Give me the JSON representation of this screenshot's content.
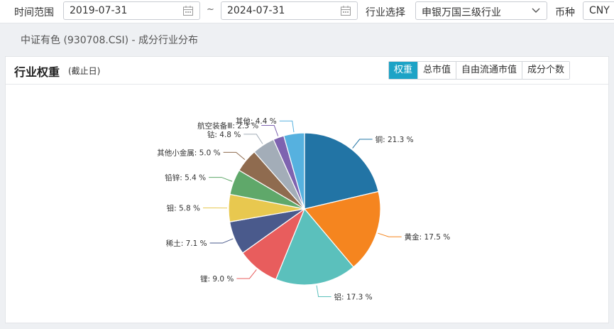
{
  "filters": {
    "time_range_label": "时间范围",
    "start_date": "2019-07-31",
    "separator": "~",
    "end_date": "2024-07-31",
    "industry_label": "行业选择",
    "industry_value": "申银万国三级行业",
    "currency_label": "币种",
    "currency_value": "CNY"
  },
  "page": {
    "subtitle": "中证有色 (930708.CSI) - 成分行业分布"
  },
  "panel": {
    "title": "行业权重",
    "subtitle": "(截止日)",
    "tabs": [
      "权重",
      "总市值",
      "自由流通市值",
      "成分个数"
    ],
    "active_tab": 0
  },
  "chart_data": {
    "type": "pie",
    "title": "",
    "slices": [
      {
        "name": "铜",
        "value": 21.3,
        "label": "铜: 21.3 %",
        "color": "#2274a5"
      },
      {
        "name": "黄金",
        "value": 17.5,
        "label": "黄金: 17.5 %",
        "color": "#f5851f"
      },
      {
        "name": "铝",
        "value": 17.3,
        "label": "铝: 17.3 %",
        "color": "#5bc0bc"
      },
      {
        "name": "锂",
        "value": 9.0,
        "label": "锂: 9.0 %",
        "color": "#e85d5d"
      },
      {
        "name": "稀土",
        "value": 7.1,
        "label": "稀土: 7.1 %",
        "color": "#4a5a8c"
      },
      {
        "name": "钼",
        "value": 5.8,
        "label": "钼: 5.8 %",
        "color": "#e8c84f"
      },
      {
        "name": "铅锌",
        "value": 5.4,
        "label": "铅锌: 5.4 %",
        "color": "#5fa86a"
      },
      {
        "name": "其他小金属",
        "value": 5.0,
        "label": "其他小金属: 5.0 %",
        "color": "#8f6b4f"
      },
      {
        "name": "钴",
        "value": 4.8,
        "label": "钴: 4.8 %",
        "color": "#a3adb8"
      },
      {
        "name": "航空装备Ⅲ",
        "value": 2.3,
        "label": "航空装备Ⅲ: 2.3 %",
        "color": "#7e63b0"
      },
      {
        "name": "其他",
        "value": 4.4,
        "label": "其他: 4.4 %",
        "color": "#56b1df"
      }
    ]
  }
}
